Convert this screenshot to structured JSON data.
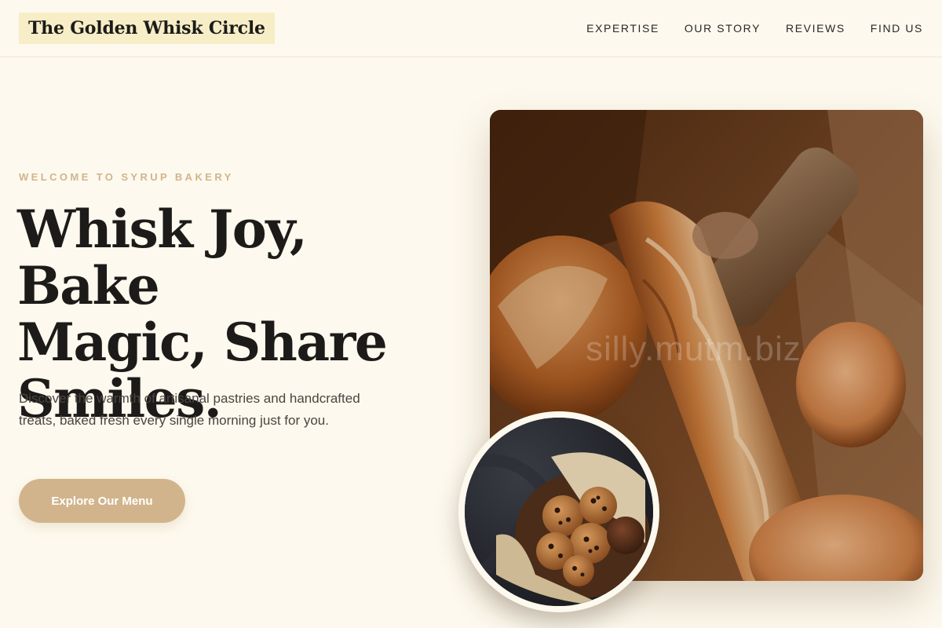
{
  "brand": {
    "name": "The Golden Whisk Circle"
  },
  "nav": {
    "items": [
      {
        "label": "EXPERTISE"
      },
      {
        "label": "OUR STORY"
      },
      {
        "label": "REVIEWS"
      },
      {
        "label": "FIND US"
      }
    ]
  },
  "hero": {
    "eyebrow": "WELCOME TO SYRUP BAKERY",
    "headline_lines": [
      "Whisk Joy, Bake",
      "Magic, Share",
      "Smiles."
    ],
    "description": "Discover the warmth of artisanal pastries and handcrafted treats, baked fresh every single morning just for you.",
    "cta_label": "Explore Our Menu",
    "image_watermark": "silly.mutm.biz",
    "main_image_icon": "bread-loaves-photo",
    "secondary_image_icon": "cookies-bowl-photo"
  },
  "colors": {
    "background": "#fdf9ee",
    "accent": "#d2b48c",
    "logo_highlight": "#f7edc6",
    "text_dark": "#1c1b19"
  }
}
